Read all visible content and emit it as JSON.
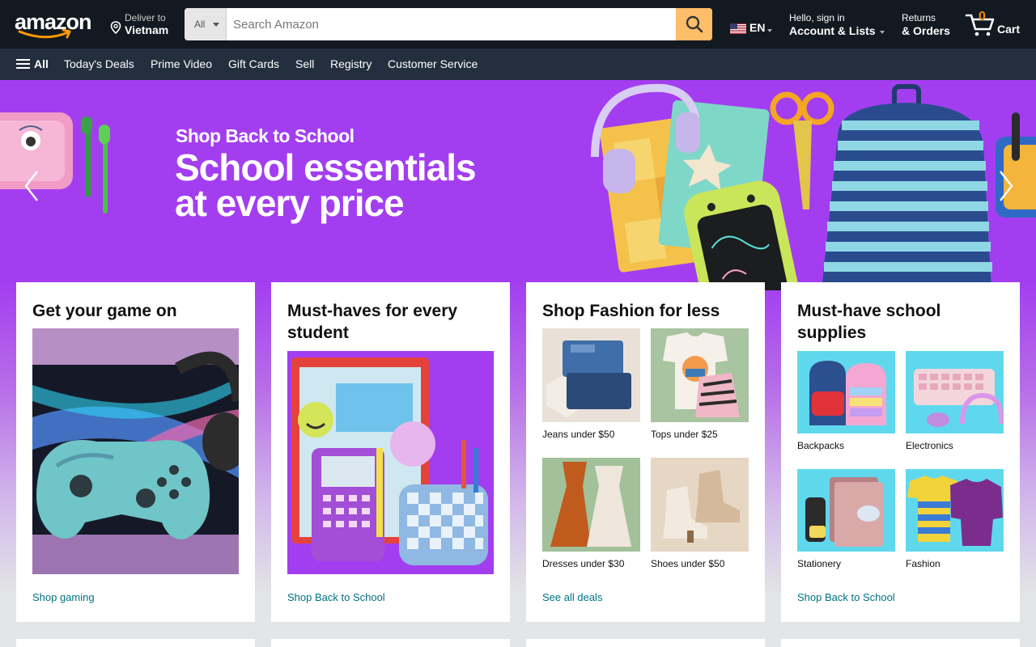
{
  "header": {
    "logo_text": "amazon",
    "deliver": {
      "line1": "Deliver to",
      "line2": "Vietnam"
    },
    "search": {
      "category": "All",
      "placeholder": "Search Amazon"
    },
    "language": "EN",
    "account": {
      "line1": "Hello, sign in",
      "line2": "Account & Lists"
    },
    "returns": {
      "line1": "Returns",
      "line2": "& Orders"
    },
    "cart": {
      "count": "0",
      "label": "Cart"
    }
  },
  "subnav": {
    "all_label": "All",
    "links": [
      "Today's Deals",
      "Prime Video",
      "Gift Cards",
      "Sell",
      "Registry",
      "Customer Service"
    ]
  },
  "hero": {
    "kicker": "Shop Back to School",
    "headline": "School essentials at every price"
  },
  "cards": [
    {
      "title": "Get your game on",
      "link": "Shop gaming"
    },
    {
      "title": "Must-haves for every student",
      "link": "Shop Back to School"
    },
    {
      "title": "Shop Fashion for less",
      "link": "See all deals",
      "items": [
        "Jeans under $50",
        "Tops under $25",
        "Dresses under $30",
        "Shoes under $50"
      ]
    },
    {
      "title": "Must-have school supplies",
      "link": "Shop Back to School",
      "items": [
        "Backpacks",
        "Electronics",
        "Stationery",
        "Fashion"
      ]
    }
  ],
  "colors": {
    "nav_dark": "#131921",
    "nav_sub": "#232f3e",
    "search_button": "#febd69",
    "hero_purple": "#a33ef0",
    "link": "#007185",
    "cart_count": "#f08804"
  },
  "icons": [
    "location-pin-icon",
    "search-icon",
    "cart-icon",
    "hamburger-icon",
    "chevron-left-icon",
    "chevron-right-icon",
    "flag-us-icon"
  ]
}
